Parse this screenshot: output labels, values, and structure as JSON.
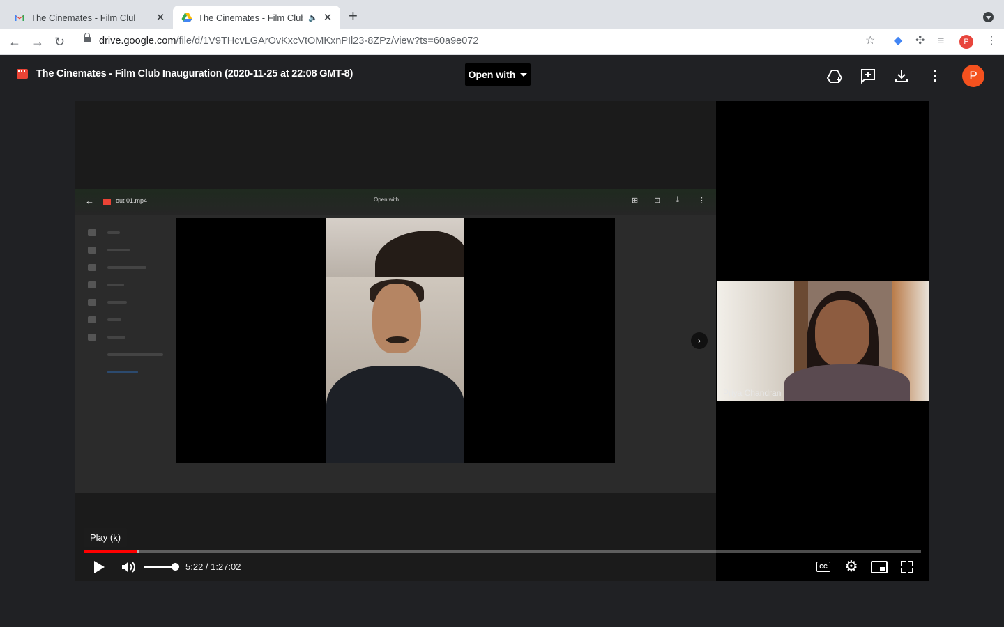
{
  "browser": {
    "tabs": [
      {
        "title": "The Cinemates - Film Club Inaug",
        "favicon": "gmail-icon",
        "active": false
      },
      {
        "title": "The Cinemates - Film Club",
        "favicon": "google-drive-icon",
        "active": true,
        "audio": true
      }
    ],
    "url_domain": "drive.google.com",
    "url_path": "/file/d/1V9THcvLGArOvKxcVtOMKxnPIl23-8ZPz/view?ts=60a9e072",
    "profile_initial": "P"
  },
  "drive": {
    "file_title": "The Cinemates - Film Club Inauguration (2020-11-25 at 22:08 GMT-8)",
    "open_with_label": "Open with",
    "avatar_initial": "P",
    "accent": "#f4511e"
  },
  "video": {
    "screen_share": {
      "file_name": "out 01.mp4",
      "open_with_label": "Open with"
    },
    "participant_name": "Priya Chandran",
    "tooltip": "Play (k)",
    "time_display": "5:22 / 1:27:02",
    "progress_played": 0.063,
    "progress_buffered": 0.066,
    "volume": 1.0,
    "progress_color": "#ff0000"
  }
}
